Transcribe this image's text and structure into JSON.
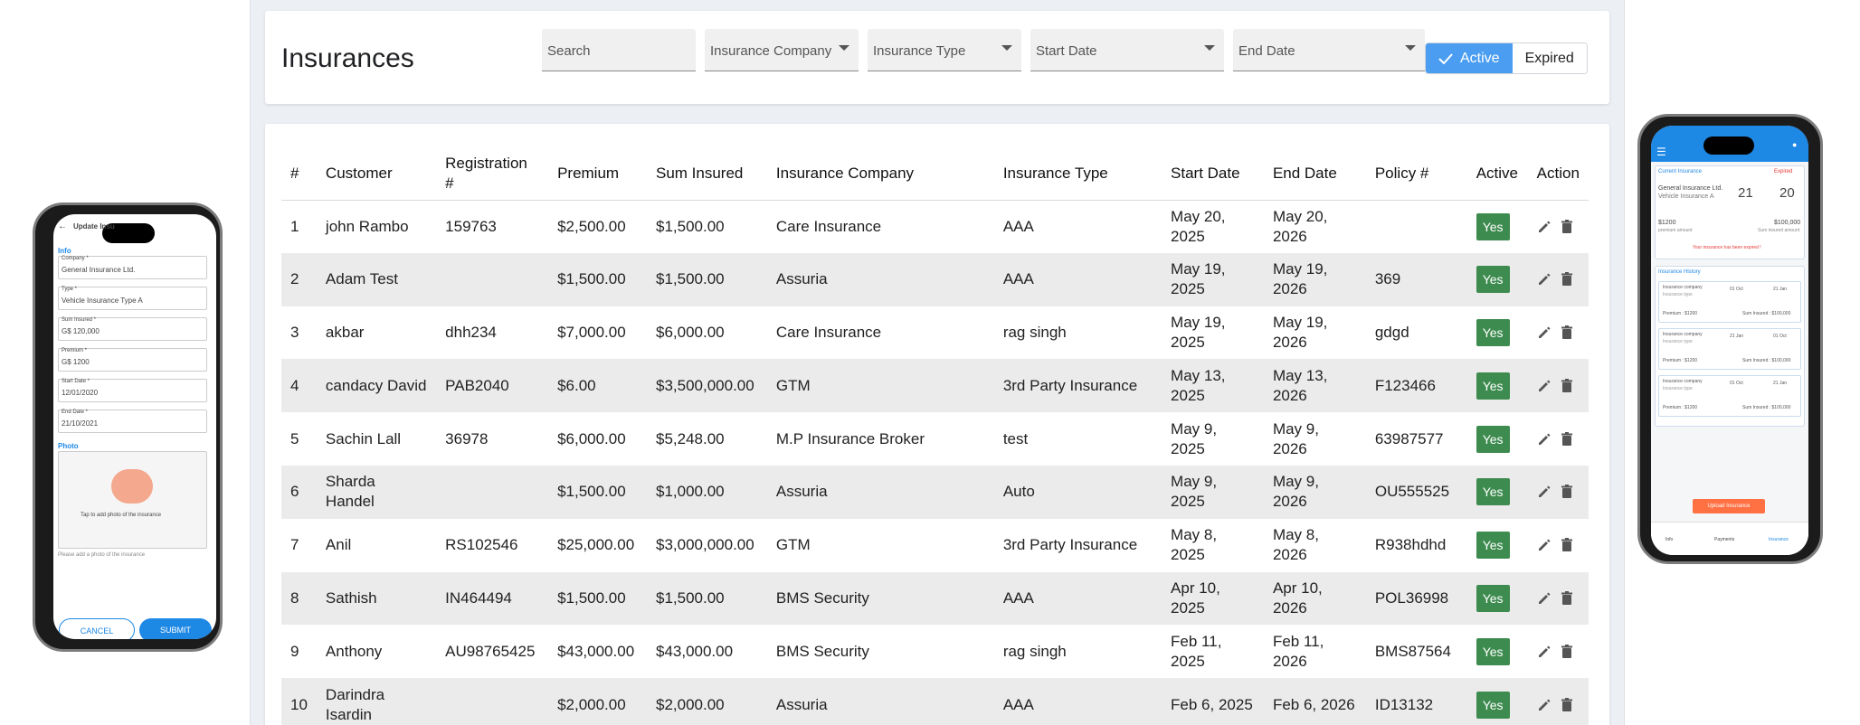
{
  "page": {
    "title": "Insurances"
  },
  "filters": {
    "search_placeholder": "Search",
    "company_label": "Insurance Company",
    "type_label": "Insurance Type",
    "start_label": "Start Date",
    "end_label": "End Date",
    "active_label": "Active",
    "expired_label": "Expired"
  },
  "table": {
    "headers": [
      "#",
      "Customer",
      "Registration #",
      "Premium",
      "Sum Insured",
      "Insurance Company",
      "Insurance Type",
      "Start Date",
      "End Date",
      "Policy #",
      "Active",
      "Action"
    ],
    "rows": [
      [
        "1",
        "john Rambo",
        "159763",
        "$2,500.00",
        "$1,500.00",
        "Care Insurance",
        "AAA",
        "May 20, 2025",
        "May 20, 2026",
        "",
        "Yes"
      ],
      [
        "2",
        "Adam Test",
        "",
        "$1,500.00",
        "$1,500.00",
        "Assuria",
        "AAA",
        "May 19, 2025",
        "May 19, 2026",
        "369",
        "Yes"
      ],
      [
        "3",
        "akbar",
        "dhh234",
        "$7,000.00",
        "$6,000.00",
        "Care Insurance",
        "rag singh",
        "May 19, 2025",
        "May 19, 2026",
        "gdgd",
        "Yes"
      ],
      [
        "4",
        "candacy David",
        "PAB2040",
        "$6.00",
        "$3,500,000.00",
        "GTM",
        "3rd Party Insurance",
        "May 13, 2025",
        "May 13, 2026",
        "F123466",
        "Yes"
      ],
      [
        "5",
        "Sachin Lall",
        "36978",
        "$6,000.00",
        "$5,248.00",
        "M.P Insurance Broker",
        "test",
        "May 9, 2025",
        "May 9, 2026",
        "63987577",
        "Yes"
      ],
      [
        "6",
        "Sharda Handel",
        "",
        "$1,500.00",
        "$1,000.00",
        "Assuria",
        "Auto",
        "May 9, 2025",
        "May 9, 2026",
        "OU555525",
        "Yes"
      ],
      [
        "7",
        "Anil",
        "RS102546",
        "$25,000.00",
        "$3,000,000.00",
        "GTM",
        "3rd Party Insurance",
        "May 8, 2025",
        "May 8, 2026",
        "R938hdhd",
        "Yes"
      ],
      [
        "8",
        "Sathish",
        "IN464494",
        "$1,500.00",
        "$1,500.00",
        "BMS Security",
        "AAA",
        "Apr 10, 2025",
        "Apr 10, 2026",
        "POL36998",
        "Yes"
      ],
      [
        "9",
        "Anthony",
        "AU98765425",
        "$43,000.00",
        "$43,000.00",
        "BMS Security",
        "rag singh",
        "Feb 11, 2025",
        "Feb 11, 2026",
        "BMS87564",
        "Yes"
      ],
      [
        "10",
        "Darindra Isardin",
        "",
        "$2,000.00",
        "$2,000.00",
        "Assuria",
        "AAA",
        "Feb 6, 2025",
        "Feb 6, 2026",
        "ID13132",
        "Yes"
      ]
    ]
  },
  "phone_left": {
    "title": "Update Insu",
    "section_info": "Info",
    "company_label": "Company *",
    "company_value": "General Insurance Ltd.",
    "type_label": "Type *",
    "type_value": "Vehicle Insurance Type A",
    "sum_label": "Sum Insured *",
    "sum_value": "G$ 120,000",
    "premium_label": "Premium *",
    "premium_value": "G$ 1200",
    "start_label": "Start Date *",
    "start_value": "12/01/2020",
    "end_label": "End Date *",
    "end_value": "21/10/2021",
    "photo_label": "Photo",
    "photo_hint": "Tap to add photo of the insurance",
    "photo_help": "Please add a photo of the insurance",
    "cancel": "CANCEL",
    "submit": "SUBMIT"
  },
  "phone_right": {
    "current_label": "Current Insurance",
    "expired_badge": "Expired",
    "company": "General Insurance Ltd.",
    "type": "Vehicle Insurance A",
    "from_day": "21",
    "to_day": "20",
    "premium": "$1200",
    "premium_label": "premium amount",
    "sum": "$100,000",
    "sum_label": "Sum insured amount",
    "warning": "Your insurance has been expired !",
    "history_label": "Insurance History",
    "history": [
      {
        "company": "Insurance company",
        "type": "Insurance type",
        "from": "01 Oct",
        "to": "21 Jan",
        "premium": "Premium : $1200",
        "sum": "Sum Insured : $100,000"
      },
      {
        "company": "Insurance company",
        "type": "Insurance type",
        "from": "21 Jan",
        "to": "01 Oct",
        "premium": "Premium : $1200",
        "sum": "Sum Insured : $100,000"
      },
      {
        "company": "Insurance company",
        "type": "Insurance type",
        "from": "01 Oct",
        "to": "21 Jan",
        "premium": "Premium : $1200",
        "sum": "Sum Insured : $100,000"
      }
    ],
    "upload": "Upload Insurance",
    "nav": [
      "Info",
      "Payments",
      "Insurance"
    ]
  },
  "colors": {
    "accent": "#4a9df0",
    "badge": "#3d8b4f",
    "phone_blue": "#1e88e5",
    "upload": "#ff7043"
  }
}
